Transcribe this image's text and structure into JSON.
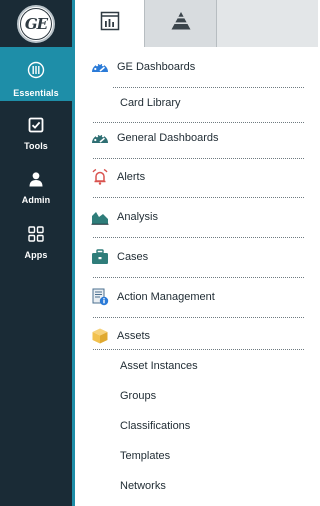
{
  "rail": {
    "logo_text": "GE",
    "items": [
      {
        "label": "Essentials",
        "icon": "essentials-icon"
      },
      {
        "label": "Tools",
        "icon": "checkbox-icon"
      },
      {
        "label": "Admin",
        "icon": "person-icon"
      },
      {
        "label": "Apps",
        "icon": "grid-icon"
      }
    ]
  },
  "tabs": [
    {
      "name": "dashboard-tab",
      "icon": "window-chart-icon"
    },
    {
      "name": "hierarchy-tab",
      "icon": "pyramid-icon"
    },
    {
      "name": "blank-tab"
    }
  ],
  "menu": {
    "ge_dashboards": "GE Dashboards",
    "card_library": "Card Library",
    "general_dashboards": "General Dashboards",
    "alerts": "Alerts",
    "analysis": "Analysis",
    "cases": "Cases",
    "action_management": "Action Management",
    "assets": "Assets",
    "asset_instances": "Asset Instances",
    "groups": "Groups",
    "classifications": "Classifications",
    "templates": "Templates",
    "networks": "Networks"
  },
  "colors": {
    "rail_bg": "#1a2b36",
    "accent": "#1e8ea8",
    "alert_red": "#d9534f",
    "analysis_teal": "#2f7d7a",
    "asset_yellow": "#f2c14e"
  }
}
